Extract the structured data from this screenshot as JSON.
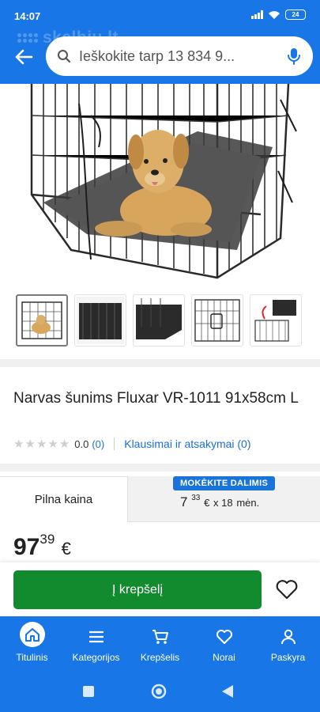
{
  "status_bar": {
    "time": "14:07",
    "battery": "24"
  },
  "header": {
    "watermark": "skelbiu.lt",
    "search_placeholder": "Ieškokite tarp 13 834 9...",
    "icons": [
      "back-arrow-icon",
      "search-icon",
      "microphone-icon"
    ]
  },
  "product": {
    "title": "Narvas šunims Fluxar VR-1011 91x58cm L",
    "thumbnail_count": 5,
    "rating": {
      "stars": 0,
      "max_stars": 5,
      "value": "0.0",
      "count": "(0)"
    },
    "qa_link": "Klausimai ir atsakymai (0)"
  },
  "price_tabs": {
    "full_label": "Pilna kaina",
    "installment_badge": "MOKĖKITE DALIMIS",
    "installment": {
      "whole": "7",
      "cents": "33",
      "currency": "€",
      "times": "x 18",
      "period": "mėn."
    }
  },
  "price": {
    "whole": "97",
    "cents": "39",
    "currency": "€"
  },
  "cart": {
    "add_label": "Į krepšelį"
  },
  "bottom_nav": [
    {
      "label": "Titulinis",
      "icon": "home-icon",
      "active": true
    },
    {
      "label": "Kategorijos",
      "icon": "menu-icon",
      "active": false
    },
    {
      "label": "Krepšelis",
      "icon": "cart-icon",
      "active": false
    },
    {
      "label": "Norai",
      "icon": "heart-icon",
      "active": false
    },
    {
      "label": "Paskyra",
      "icon": "user-icon",
      "active": false
    }
  ],
  "colors": {
    "brand_blue": "#1976e6",
    "cart_green": "#128a2e",
    "link_blue": "#1a6fd4"
  }
}
